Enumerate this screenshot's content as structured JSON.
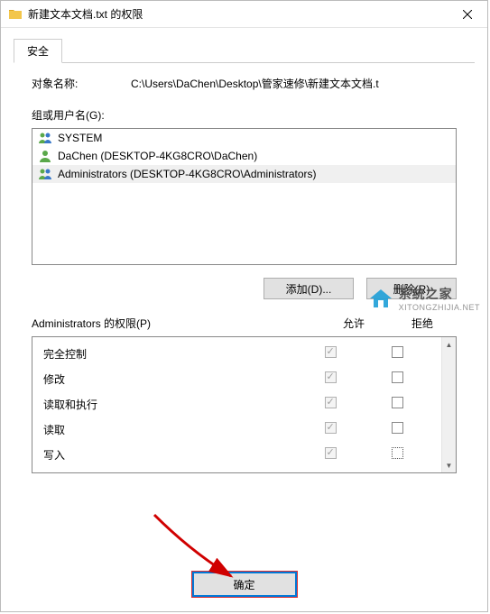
{
  "window": {
    "title": "新建文本文档.txt 的权限"
  },
  "tabs": {
    "security": "安全"
  },
  "object": {
    "label": "对象名称:",
    "path": "C:\\Users\\DaChen\\Desktop\\管家速修\\新建文本文档.t"
  },
  "groups": {
    "label": "组或用户名(G):",
    "items": [
      {
        "name": "SYSTEM",
        "icon": "group"
      },
      {
        "name": "DaChen (DESKTOP-4KG8CRO\\DaChen)",
        "icon": "user"
      },
      {
        "name": "Administrators (DESKTOP-4KG8CRO\\Administrators)",
        "icon": "group"
      }
    ],
    "selected_index": 2
  },
  "buttons": {
    "add": "添加(D)...",
    "remove": "删除(R)"
  },
  "permissions": {
    "header_label": "Administrators 的权限(P)",
    "allow_label": "允许",
    "deny_label": "拒绝",
    "rows": [
      {
        "name": "完全控制",
        "allow_checked": true,
        "allow_disabled": true,
        "deny_checked": false
      },
      {
        "name": "修改",
        "allow_checked": true,
        "allow_disabled": true,
        "deny_checked": false
      },
      {
        "name": "读取和执行",
        "allow_checked": true,
        "allow_disabled": true,
        "deny_checked": false
      },
      {
        "name": "读取",
        "allow_checked": true,
        "allow_disabled": true,
        "deny_checked": false
      },
      {
        "name": "写入",
        "allow_checked": true,
        "allow_disabled": true,
        "deny_checked": false
      }
    ]
  },
  "footer": {
    "ok": "确定"
  },
  "watermark": {
    "cn": "系统之家",
    "en": "XITONGZHIJIA.NET"
  }
}
